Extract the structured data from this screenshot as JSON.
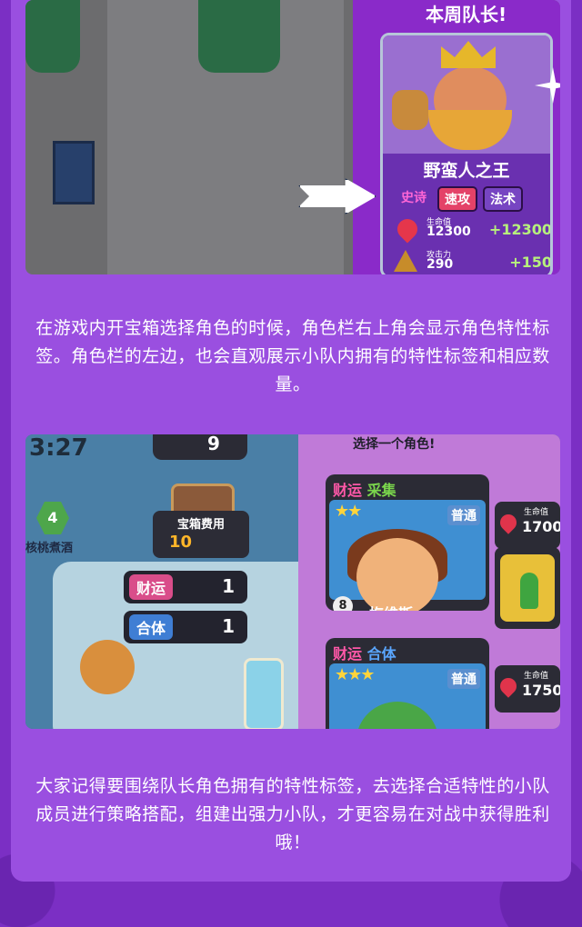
{
  "page": {
    "caption_1": "在游戏内开宝箱选择角色的时候，角色栏右上角会显示角色特性标签。角色栏的左边，也会直观展示小队内拥有的特性标签和相应数量。",
    "caption_2": "大家记得要围绕队长角色拥有的特性标签，去选择合适特性的小队成员进行策略搭配，组建出强力小队，才更容易在对战中获得胜利哦！"
  },
  "shot1": {
    "banner": "本周队长!",
    "character_name": "野蛮人之王",
    "tags": [
      "史诗",
      "速攻",
      "法术"
    ],
    "hp_label": "生命值",
    "hp_value": "12300",
    "hp_bonus": "+12300",
    "atk_label": "攻击力",
    "atk_value": "290",
    "atk_bonus": "+150"
  },
  "shot2": {
    "timer": "3:27",
    "coins": "9",
    "chest_cost_label": "宝箱费用",
    "chest_cost_value": "10",
    "level": "4",
    "level_name": "核桃煮酒",
    "traits": [
      {
        "name": "财运",
        "count": "1"
      },
      {
        "name": "合体",
        "count": "1"
      }
    ],
    "top_prompt": "选择一个角色!",
    "heroes": [
      {
        "trait_a": "财运",
        "trait_b": "采集",
        "rarity": "普通",
        "name": "梅维斯",
        "num": "8",
        "hp_label": "生命值",
        "hp": "1700"
      },
      {
        "trait_a": "财运",
        "trait_b": "合体",
        "rarity": "普通",
        "name": "",
        "num": "",
        "hp_label": "生命值",
        "hp": "1750"
      }
    ]
  }
}
